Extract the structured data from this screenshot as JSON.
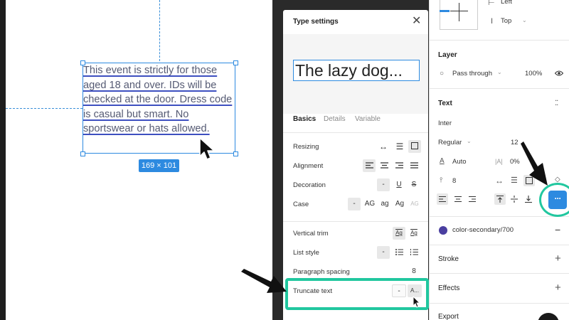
{
  "canvas": {
    "text_content": "This event is strictly for those aged 18 and over. IDs will be checked at the door. Dress code is casual but smart. No sportswear or hats allowed.",
    "size_badge": "169 × 101"
  },
  "type_settings": {
    "title": "Type settings",
    "preview_text": "The lazy dog...",
    "tabs": [
      "Basics",
      "Details",
      "Variable"
    ],
    "rows": {
      "resizing": "Resizing",
      "alignment": "Alignment",
      "decoration": "Decoration",
      "decoration_none": "-",
      "decoration_underline": "U",
      "decoration_strike": "S",
      "case": "Case",
      "case_none": "-",
      "case_upper": "AG",
      "case_lower": "ag",
      "case_title": "Ag",
      "case_smallcaps": "AG",
      "vertical_trim": "Vertical trim",
      "vertical_trim_opt1": "Ag",
      "vertical_trim_opt2": "Ag",
      "list_style": "List style",
      "list_none": "-",
      "paragraph_spacing": "Paragraph spacing",
      "paragraph_spacing_value": "8",
      "truncate_text": "Truncate text",
      "truncate_none": "-",
      "truncate_ellipsis": "A..."
    }
  },
  "properties": {
    "constraints": {
      "horizontal": "Left",
      "vertical": "Top"
    },
    "layer": {
      "title": "Layer",
      "blend_mode": "Pass through",
      "opacity": "100%"
    },
    "text": {
      "title": "Text",
      "font_family": "Inter",
      "font_weight": "Regular",
      "font_size": "12",
      "line_height": "Auto",
      "letter_spacing_prefix": "|A|",
      "letter_spacing": "0%",
      "paragraph_spacing": "8",
      "more_label": "···"
    },
    "fill": {
      "style_name": "color-secondary/700",
      "color": "#4a3fa0",
      "remove": "−"
    },
    "stroke": {
      "title": "Stroke"
    },
    "effects": {
      "title": "Effects"
    },
    "export": {
      "title": "Export"
    }
  },
  "colors": {
    "accent_blue": "#2d8ae0",
    "highlight_teal": "#21c79f",
    "text_color": "#555a73"
  }
}
